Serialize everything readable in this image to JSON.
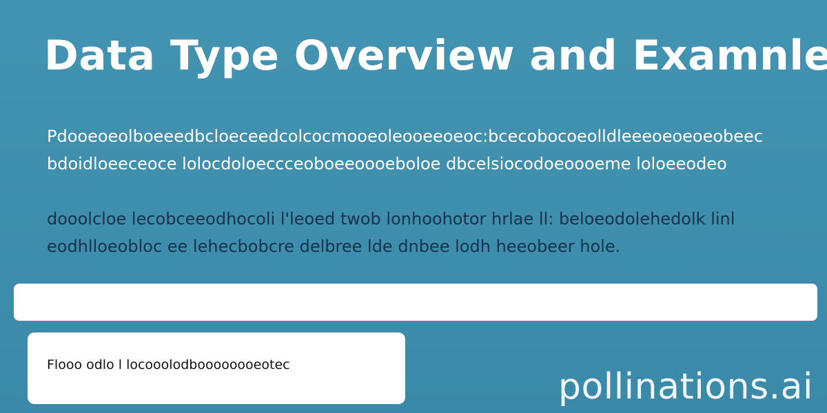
{
  "header": {
    "title": "Data Type Overview and Examnles"
  },
  "intro": {
    "line_1": "Pdooeoeolboeeedbcloeceedcolcocmooeoleooeeoeoc:bcecobocoeolldleeeoeoeoeobeeceo:",
    "line_2": "bdoidloeeceoce lolocdoloeccceoboeeoooeboloe dbcelsiocodoeoooeme loloeeodeo"
  },
  "details": {
    "line_1": "dooolcloe lecobceeodhocoli l'leoed twob lonhoohotor hrlae ll: beloeodolehedolk linl",
    "line_2": "eodhlloeobloc ee lehecbobcre delbree lde dnbee lodh heeobeer hole."
  },
  "search": {
    "value": ""
  },
  "card": {
    "text": "Flooo odlo l locooolodboooooooeotec"
  },
  "watermark": {
    "text": "pollinations.ai"
  }
}
